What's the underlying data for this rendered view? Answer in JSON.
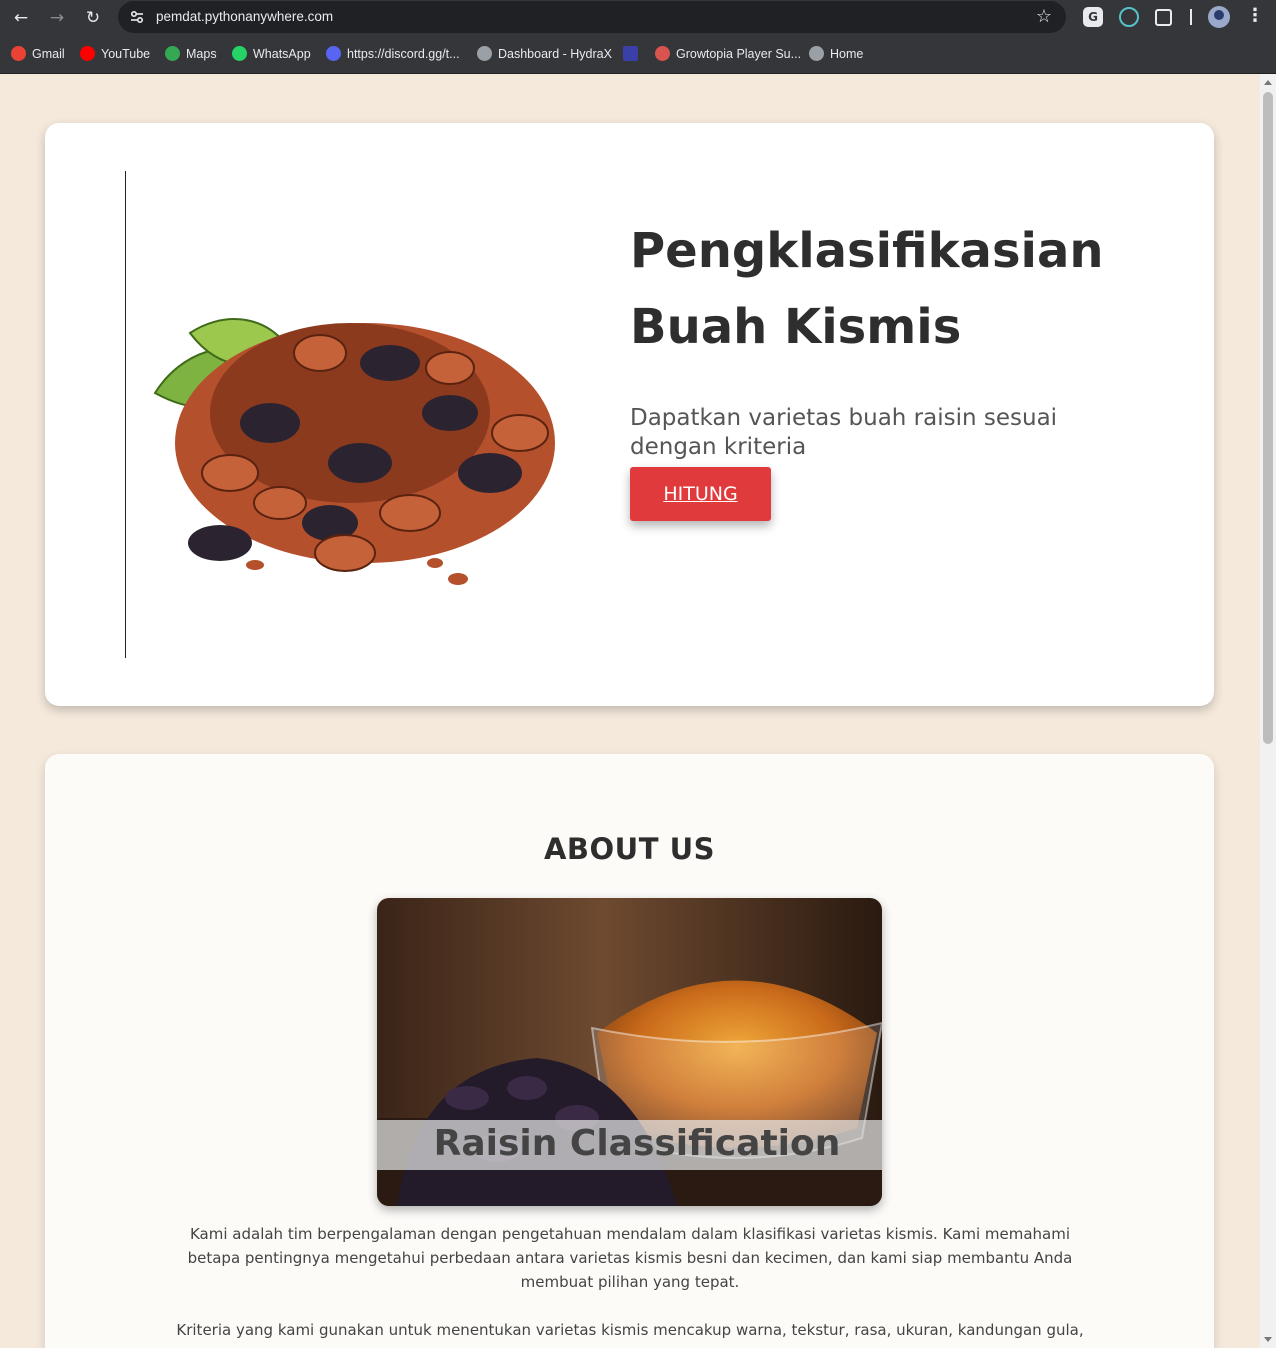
{
  "browser": {
    "url": "pemdat.pythonanywhere.com",
    "bookmarks": [
      {
        "label": "Gmail",
        "color": "#ea4335"
      },
      {
        "label": "YouTube",
        "color": "#ff0000"
      },
      {
        "label": "Maps",
        "color": "#34a853"
      },
      {
        "label": "WhatsApp",
        "color": "#25d366"
      },
      {
        "label": "https://discord.gg/t...",
        "color": "#5865f2"
      },
      {
        "label": "Dashboard - HydraX",
        "color": "#9aa0a6"
      },
      {
        "label": "",
        "color": "#3b3fa8"
      },
      {
        "label": "Growtopia Player Su...",
        "color": "#d9534f"
      },
      {
        "label": "Home",
        "color": "#9aa0a6"
      }
    ],
    "extension_g_label": "G"
  },
  "hero": {
    "title": "Pengklasifikasian Buah Kismis",
    "subtitle": "Dapatkan varietas buah raisin sesuai dengan kriteria",
    "button_label": "HITUNG",
    "accent_color": "#e03a3c"
  },
  "about": {
    "title": "ABOUT US",
    "image_caption": "Raisin Classification",
    "paragraph1": "Kami adalah tim berpengalaman dengan pengetahuan mendalam dalam klasifikasi varietas kismis. Kami memahami betapa pentingnya mengetahui perbedaan antara varietas kismis besni dan kecimen, dan kami siap membantu Anda membuat pilihan yang tepat.",
    "paragraph2": "Kriteria yang kami gunakan untuk menentukan varietas kismis mencakup warna, tekstur, rasa, ukuran, kandungan gula,"
  }
}
